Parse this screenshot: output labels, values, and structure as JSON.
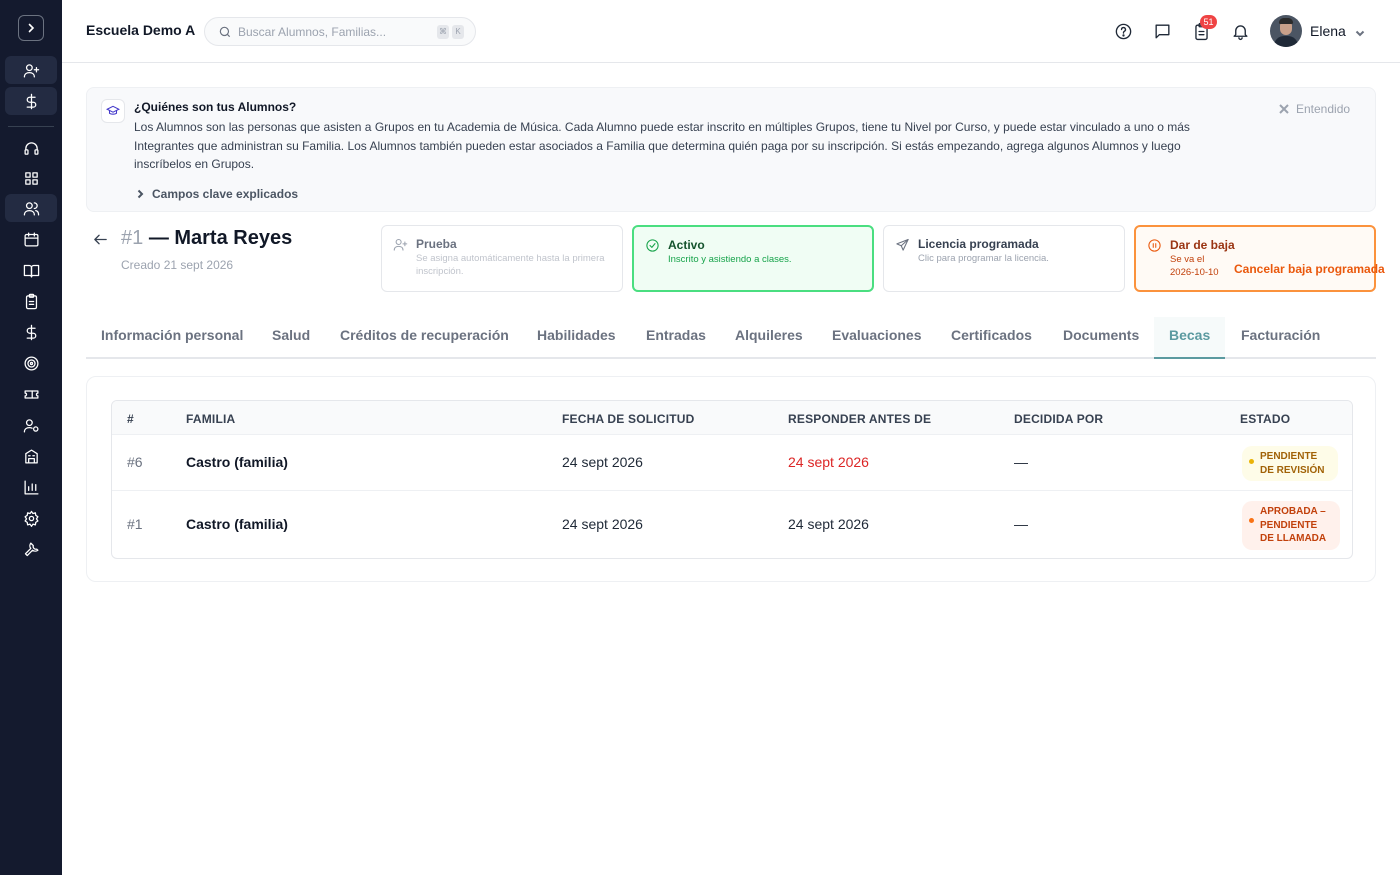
{
  "header": {
    "school_name": "Escuela Demo A",
    "search_placeholder": "Buscar Alumnos, Familias...",
    "shortcut_keys": [
      "⌘",
      "K"
    ],
    "notifications_count": "51",
    "user_name": "Elena"
  },
  "banner": {
    "title": "¿Quiénes son tus Alumnos?",
    "body": "Los Alumnos son las personas que asisten a Grupos en tu Academia de Música. Cada Alumno puede estar inscrito en múltiples Grupos, tiene tu Nivel por Curso, y puede estar vinculado a uno o más Integrantes que administran su Familia. Los Alumnos también pueden estar asociados a Familia que determina quién paga por su inscripción. Si estás empezando, agrega algunos Alumnos y luego inscríbelos en Grupos.",
    "dismiss_label": "Entendido",
    "expand_label": "Campos clave explicados"
  },
  "student": {
    "number": "#1",
    "name": "— Marta Reyes",
    "created": "Creado 21 sept 2026"
  },
  "status_cards": [
    {
      "title": "Prueba",
      "description": "Se asigna automáticamente hasta la primera inscripción."
    },
    {
      "title": "Activo",
      "description": "Inscrito y asistiendo a clases."
    },
    {
      "title": "Licencia programada",
      "description": "Clic para programar la licencia."
    },
    {
      "title": "Dar de baja",
      "description": "Se va el 2026-10-10",
      "action": "Cancelar baja programada"
    }
  ],
  "tabs": [
    "Información personal",
    "Salud",
    "Créditos de recuperación",
    "Habilidades",
    "Entradas",
    "Alquileres",
    "Evaluaciones",
    "Certificados",
    "Documents",
    "Becas",
    "Facturación"
  ],
  "active_tab": "Becas",
  "scholarships": {
    "columns": [
      "#",
      "FAMILIA",
      "FECHA DE SOLICITUD",
      "RESPONDER ANTES DE",
      "DECIDIDA POR",
      "ESTADO"
    ],
    "rows": [
      {
        "id": "#6",
        "family": "Castro (familia)",
        "requested": "24 sept 2026",
        "respond_by": "24 sept 2026",
        "decided_by": "—",
        "status": "PENDIENTE DE REVISIÓN"
      },
      {
        "id": "#1",
        "family": "Castro (familia)",
        "requested": "24 sept 2026",
        "respond_by": "24 sept 2026",
        "decided_by": "—",
        "status": "APROBADA – PENDIENTE DE LLAMADA"
      }
    ]
  },
  "colors": {
    "sidebar_bg": "#141a2e",
    "active_tab": "#5b9aa0",
    "active_status": "#4ade80",
    "withdraw_status": "#fb923c",
    "overdue_date": "#dc2626"
  }
}
